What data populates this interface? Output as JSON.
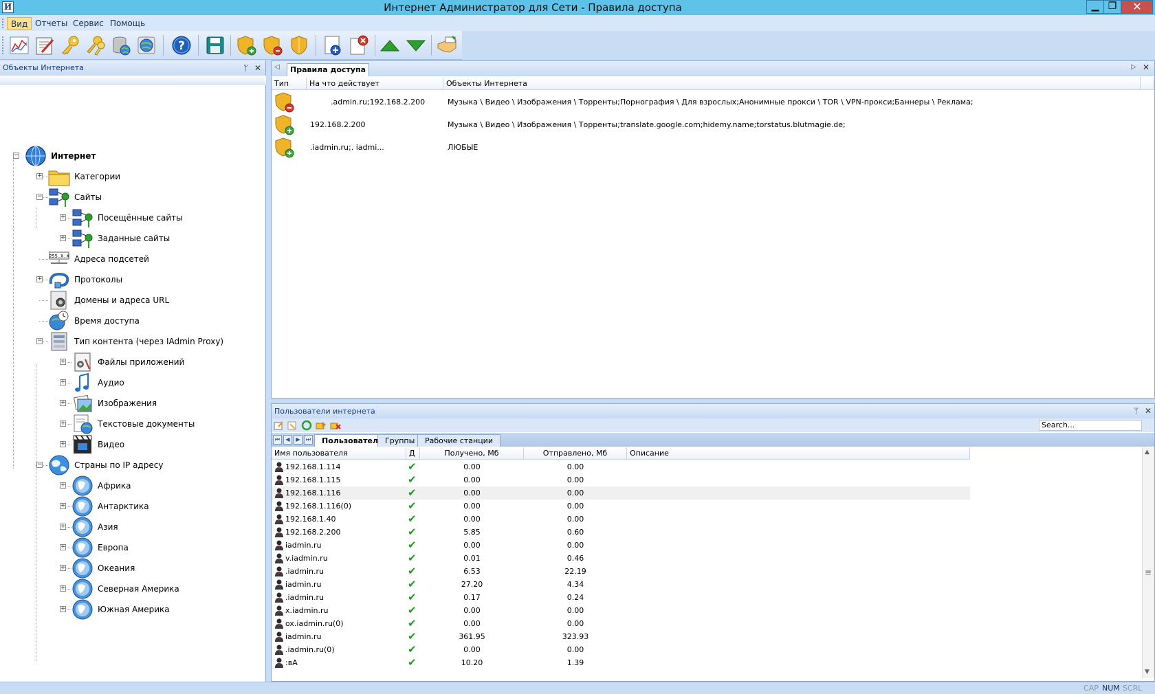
{
  "window": {
    "app_icon_letter": "И",
    "title": "Интернет Администратор для Сети - Правила доступа",
    "minimize": "▁",
    "restore": "❐",
    "close": "✕"
  },
  "menu": [
    "Вид",
    "Отчеты",
    "Сервис",
    "Помощь"
  ],
  "toolbar": {
    "icons": [
      "traffic-chart-icon",
      "report-edit-icon",
      "key-icon",
      "keys-icon",
      "database-globe-icon",
      "globe-settings-icon",
      "help-icon",
      "save-icon",
      "shield-add-icon",
      "shield-remove-icon",
      "shield-icon",
      "new-item-icon",
      "delete-item-icon",
      "move-up-icon",
      "move-down-icon",
      "handshake-icon"
    ]
  },
  "left_panel": {
    "title": "Объекты Интернета",
    "pin": "ᛘ",
    "close": "✕",
    "tree": [
      {
        "label": "Интернет",
        "level": 0,
        "bold": true,
        "icon": "globe-icon",
        "expander": "−"
      },
      {
        "label": "Категории",
        "level": 1,
        "icon": "folder-icon",
        "expander": "+"
      },
      {
        "label": "Сайты",
        "level": 1,
        "icon": "network-sites-icon",
        "expander": "−"
      },
      {
        "label": "Посещённые сайты",
        "level": 2,
        "icon": "network-sites-icon",
        "expander": "+"
      },
      {
        "label": "Заданные сайты",
        "level": 2,
        "icon": "network-sites-icon",
        "expander": "+"
      },
      {
        "label": "Адреса подсетей",
        "level": 1,
        "icon": "subnet-icon",
        "expander": ""
      },
      {
        "label": "Протоколы",
        "level": 1,
        "icon": "cable-icon",
        "expander": "+"
      },
      {
        "label": "Домены и адреса URL",
        "level": 1,
        "icon": "domain-icon",
        "expander": ""
      },
      {
        "label": "Время доступа",
        "level": 1,
        "icon": "clock-globe-icon",
        "expander": ""
      },
      {
        "label": "Тип контента (через IAdmin Proxy)",
        "level": 1,
        "icon": "content-type-icon",
        "expander": "−"
      },
      {
        "label": "Файлы приложений",
        "level": 2,
        "icon": "app-file-icon",
        "expander": "+"
      },
      {
        "label": "Аудио",
        "level": 2,
        "icon": "music-icon",
        "expander": "+"
      },
      {
        "label": "Изображения",
        "level": 2,
        "icon": "image-icon",
        "expander": "+"
      },
      {
        "label": "Текстовые документы",
        "level": 2,
        "icon": "text-doc-icon",
        "expander": "+"
      },
      {
        "label": "Видео",
        "level": 2,
        "icon": "video-icon",
        "expander": "+"
      },
      {
        "label": "Страны по IP адресу",
        "level": 1,
        "icon": "world-icon",
        "expander": "−"
      },
      {
        "label": "Африка",
        "level": 2,
        "icon": "continent-globe-icon",
        "expander": "+"
      },
      {
        "label": "Антарктика",
        "level": 2,
        "icon": "continent-globe-icon",
        "expander": "+"
      },
      {
        "label": "Азия",
        "level": 2,
        "icon": "continent-globe-icon",
        "expander": "+"
      },
      {
        "label": "Европа",
        "level": 2,
        "icon": "continent-globe-icon",
        "expander": "+"
      },
      {
        "label": "Океания",
        "level": 2,
        "icon": "continent-globe-icon",
        "expander": "+"
      },
      {
        "label": "Северная Америка",
        "level": 2,
        "icon": "continent-globe-icon",
        "expander": "+"
      },
      {
        "label": "Южная Америка",
        "level": 2,
        "icon": "continent-globe-icon",
        "expander": "+"
      }
    ]
  },
  "rules_panel": {
    "tab": "Правила доступа",
    "scroll_left": "◁",
    "scroll_right": "▷",
    "close": "✕",
    "columns": [
      "Тип",
      "На что действует",
      "Объекты Интернета"
    ],
    "rows": [
      {
        "type": "deny",
        "target": ".admin.ru;192.168.2.200",
        "objects": "Музыка \\ Видео \\ Изображения \\ Торренты;Порнография \\ Для взрослых;Анонимные прокси \\ TOR \\ VPN-прокси;Баннеры \\ Реклама;"
      },
      {
        "type": "allow",
        "target": "192.168.2.200",
        "objects": "Музыка \\ Видео \\ Изображения \\ Торренты;translate.google.com;hidemy.name;torstatus.blutmagie.de;"
      },
      {
        "type": "allow",
        "target": ".iadmin.ru;.            iadmi...",
        "objects": "ЛЮБЫЕ"
      }
    ]
  },
  "users_panel": {
    "title": "Пользователи интернета",
    "pin": "ᛘ",
    "close": "✕",
    "search_placeholder": "Search...",
    "toolbar_icons": [
      "user-edit-icon",
      "user-new-icon",
      "refresh-icon",
      "move-folder-icon",
      "delete-users-icon"
    ],
    "nav": [
      "⏮",
      "◀",
      "▶",
      "⏭"
    ],
    "tabs": [
      "Пользователи",
      "Группы",
      "Рабочие станции"
    ],
    "columns": [
      "Имя пользователя",
      "Д",
      "Получено, Мб",
      "Отправлено, Мб",
      "Описание"
    ],
    "rows": [
      {
        "name": "192.168.1.114",
        "received": "0.00",
        "sent": "0.00"
      },
      {
        "name": "192.168.1.115",
        "received": "0.00",
        "sent": "0.00"
      },
      {
        "name": "192.168.1.116",
        "received": "0.00",
        "sent": "0.00",
        "selected": true
      },
      {
        "name": "192.168.1.116(0)",
        "received": "0.00",
        "sent": "0.00"
      },
      {
        "name": "192.168.1.40",
        "received": "0.00",
        "sent": "0.00"
      },
      {
        "name": "192.168.2.200",
        "received": "5.85",
        "sent": "0.60"
      },
      {
        "name": "iadmin.ru",
        "received": "0.00",
        "sent": "0.00"
      },
      {
        "name": "v.iadmin.ru",
        "received": "0.01",
        "sent": "0.46"
      },
      {
        "name": ".iadmin.ru",
        "received": "6.53",
        "sent": "22.19"
      },
      {
        "name": "iadmin.ru",
        "received": "27.20",
        "sent": "4.34"
      },
      {
        "name": ".iadmin.ru",
        "received": "0.17",
        "sent": "0.24"
      },
      {
        "name": "x.iadmin.ru",
        "received": "0.00",
        "sent": "0.00"
      },
      {
        "name": "ox.iadmin.ru(0)",
        "received": "0.00",
        "sent": "0.00"
      },
      {
        "name": "iadmin.ru",
        "received": "361.95",
        "sent": "323.93"
      },
      {
        "name": ".iadmin.ru(0)",
        "received": "0.00",
        "sent": "0.00"
      },
      {
        "name": ":вА",
        "received": "10.20",
        "sent": "1.39"
      }
    ],
    "check": "✔",
    "scroll_up": "▲",
    "scroll_down": "▼",
    "scroll_grip": "≡"
  },
  "status": [
    "CAP",
    "NUM",
    "SCRL"
  ],
  "colors": {
    "titlebar": "#5fc2e8",
    "accent": "#1a3d7a",
    "check": "#1e9a1e",
    "shield": "#f0b429"
  }
}
